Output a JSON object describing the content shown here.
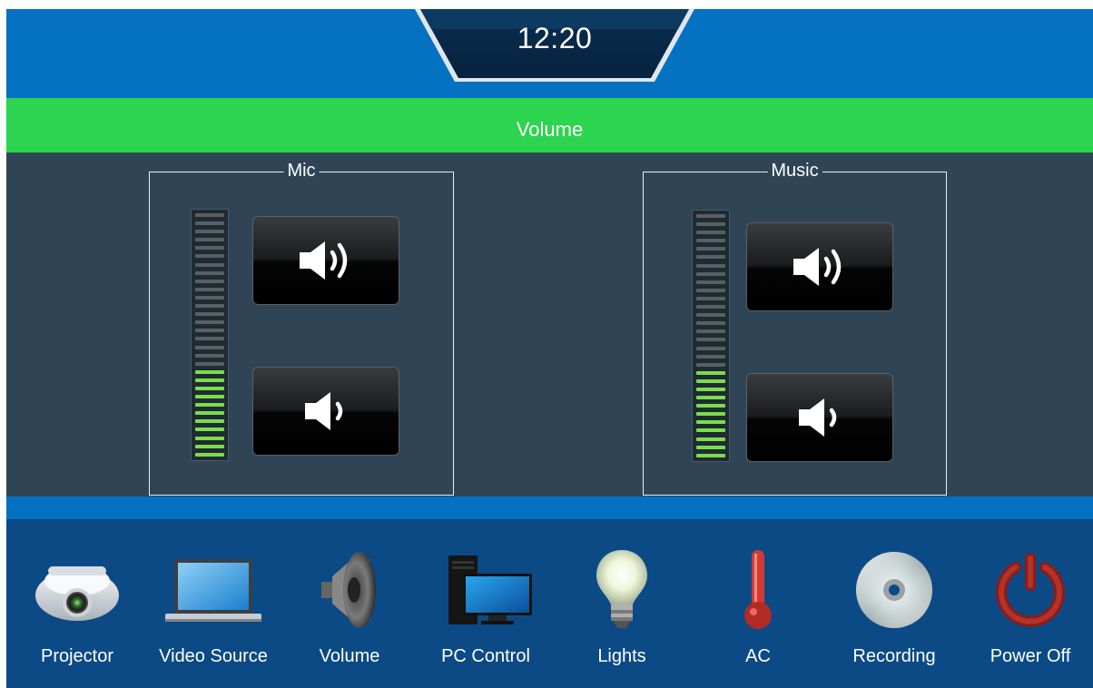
{
  "header": {
    "clock": "12:20"
  },
  "title": "Volume",
  "groups": [
    {
      "label": "Mic",
      "level": 0.36,
      "up_icon": "volume-up-icon",
      "down_icon": "volume-down-icon"
    },
    {
      "label": "Music",
      "level": 0.37,
      "up_icon": "volume-up-icon",
      "down_icon": "volume-down-icon"
    }
  ],
  "nav": {
    "items": [
      {
        "label": "Projector",
        "icon": "projector-icon"
      },
      {
        "label": "Video Source",
        "icon": "laptop-icon"
      },
      {
        "label": "Volume",
        "icon": "speaker-icon"
      },
      {
        "label": "PC Control",
        "icon": "desktop-pc-icon"
      },
      {
        "label": "Lights",
        "icon": "lightbulb-icon"
      },
      {
        "label": "AC",
        "icon": "thermometer-icon"
      },
      {
        "label": "Recording",
        "icon": "disc-icon"
      },
      {
        "label": "Power Off",
        "icon": "power-icon"
      }
    ]
  },
  "colors": {
    "header_blue": "#0571c1",
    "title_green": "#2cd450",
    "panel_bg": "#2f4556",
    "nav_bg": "#0c4a85",
    "meter_on": "#7ddc4c"
  }
}
